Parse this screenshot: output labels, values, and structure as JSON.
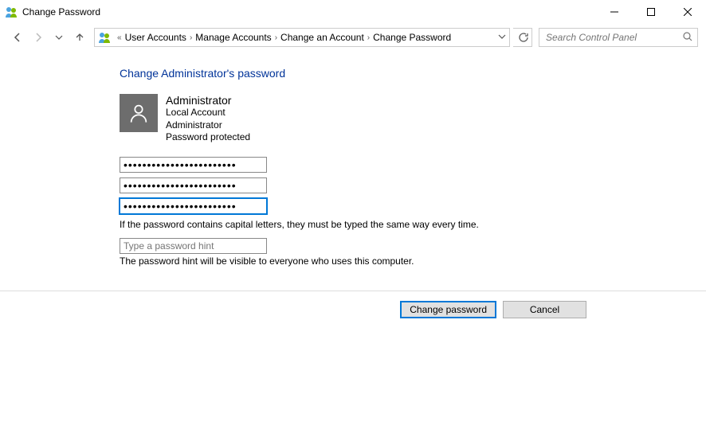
{
  "window": {
    "title": "Change Password"
  },
  "breadcrumb": {
    "prefix": "«",
    "items": [
      "User Accounts",
      "Manage Accounts",
      "Change an Account",
      "Change Password"
    ]
  },
  "search": {
    "placeholder": "Search Control Panel"
  },
  "page": {
    "heading": "Change Administrator's password",
    "user": {
      "name": "Administrator",
      "type": "Local Account",
      "role": "Administrator",
      "status": "Password protected"
    },
    "fields": {
      "current_password": "••••••••••••••••••••••••",
      "new_password": "••••••••••••••••••••••••",
      "confirm_password": "••••••••••••••••••••••••",
      "hint_placeholder": "Type a password hint"
    },
    "note_caps": "If the password contains capital letters, they must be typed the same way every time.",
    "note_hint": "The password hint will be visible to everyone who uses this computer."
  },
  "buttons": {
    "primary": "Change password",
    "cancel": "Cancel"
  }
}
